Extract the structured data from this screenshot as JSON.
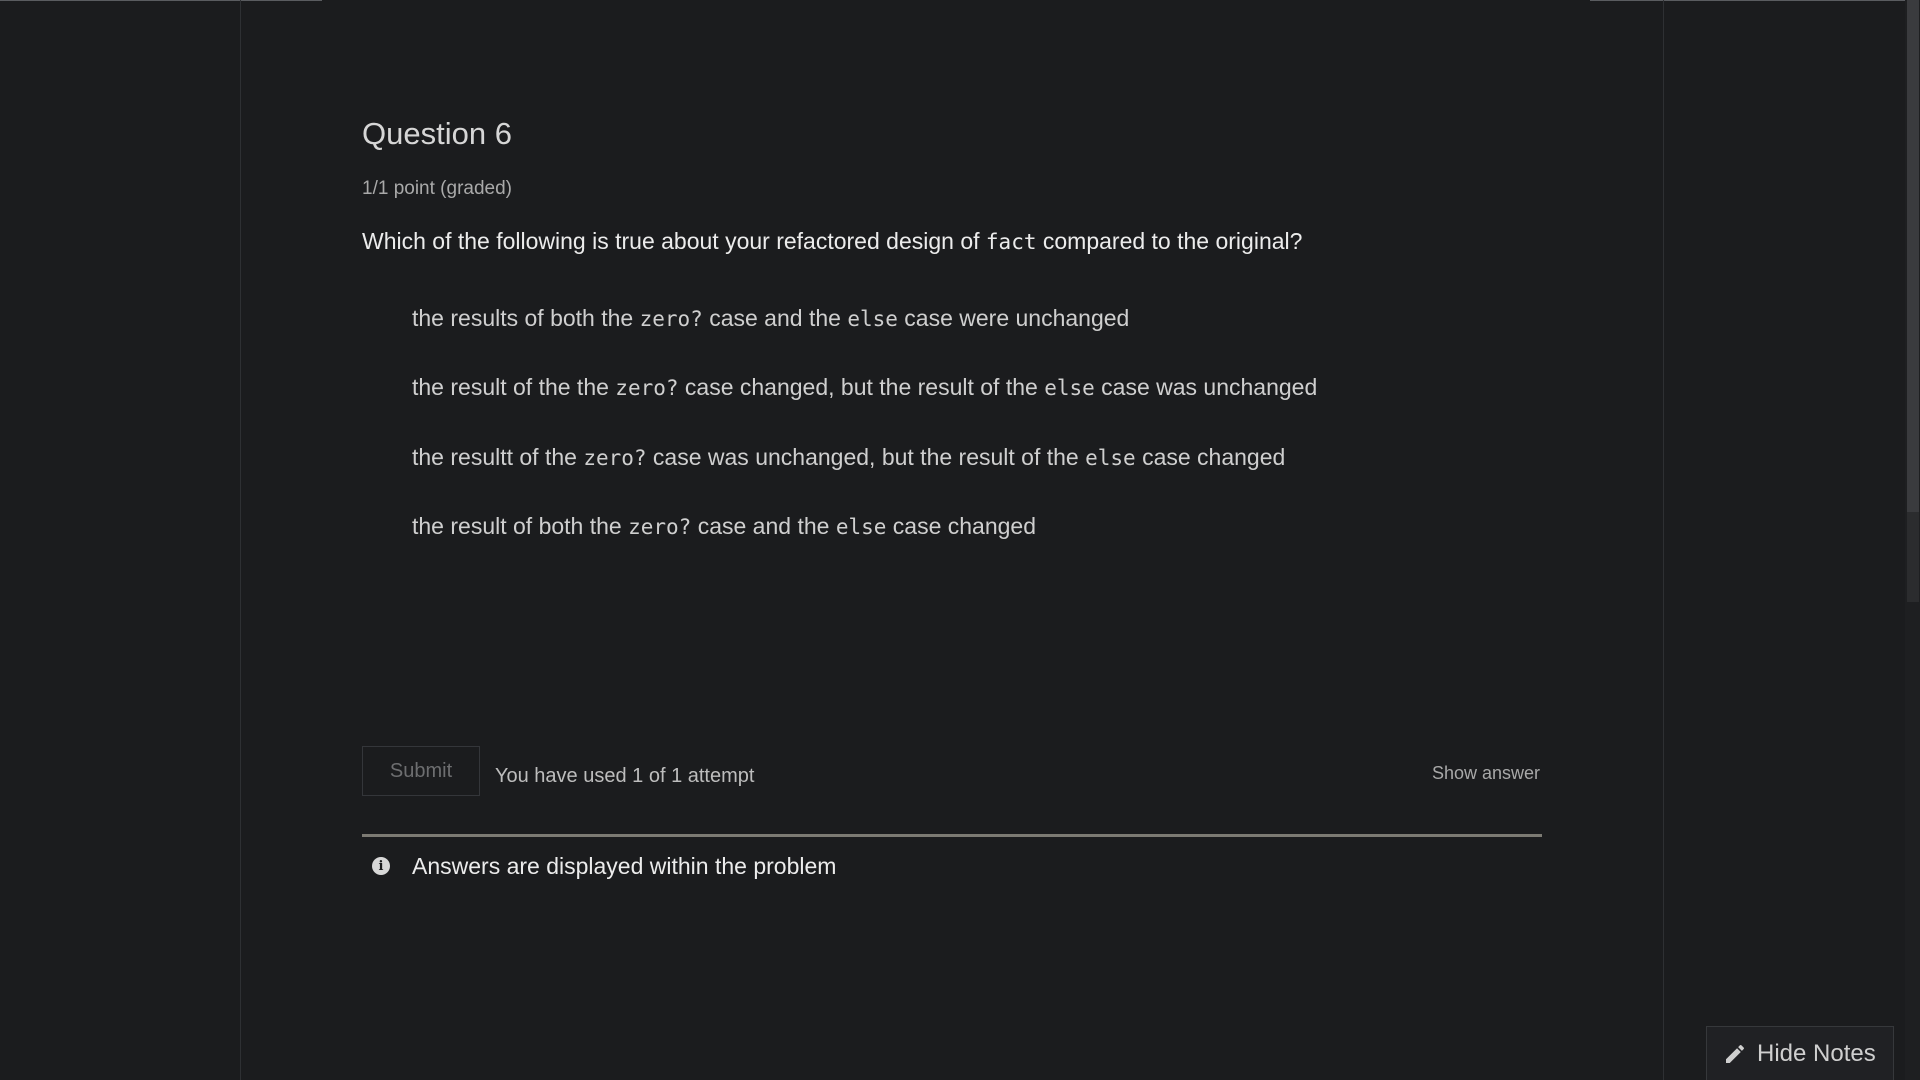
{
  "question": {
    "title": "Question 6",
    "points": "1/1 point (graded)",
    "prompt_before": "Which of the following is true about your refactored design of ",
    "prompt_code": "fact",
    "prompt_after": " compared to the original?"
  },
  "choices": [
    {
      "parts": [
        "the results of both the ",
        "zero?",
        " case and the ",
        "else",
        " case were unchanged"
      ]
    },
    {
      "parts": [
        "the result of the the ",
        "zero?",
        " case changed, but the result of the ",
        "else",
        " case was unchanged"
      ]
    },
    {
      "parts": [
        "the resultt of the ",
        "zero?",
        " case was unchanged, but the result of the ",
        "else",
        " case changed"
      ]
    },
    {
      "parts": [
        "the result of both the ",
        "zero?",
        " case and the ",
        "else",
        " case changed"
      ]
    }
  ],
  "actions": {
    "submit_label": "Submit",
    "attempts_text": "You have used 1 of 1 attempt",
    "show_answer_label": "Show answer"
  },
  "notification": {
    "icon": "info-icon",
    "text": "Answers are displayed within the problem"
  },
  "notes_button": {
    "icon": "pencil-icon",
    "label": "Hide Notes"
  },
  "colors": {
    "background": "#1b1c1e",
    "text": "#e3e3e3",
    "divider": "#7c7a73"
  }
}
